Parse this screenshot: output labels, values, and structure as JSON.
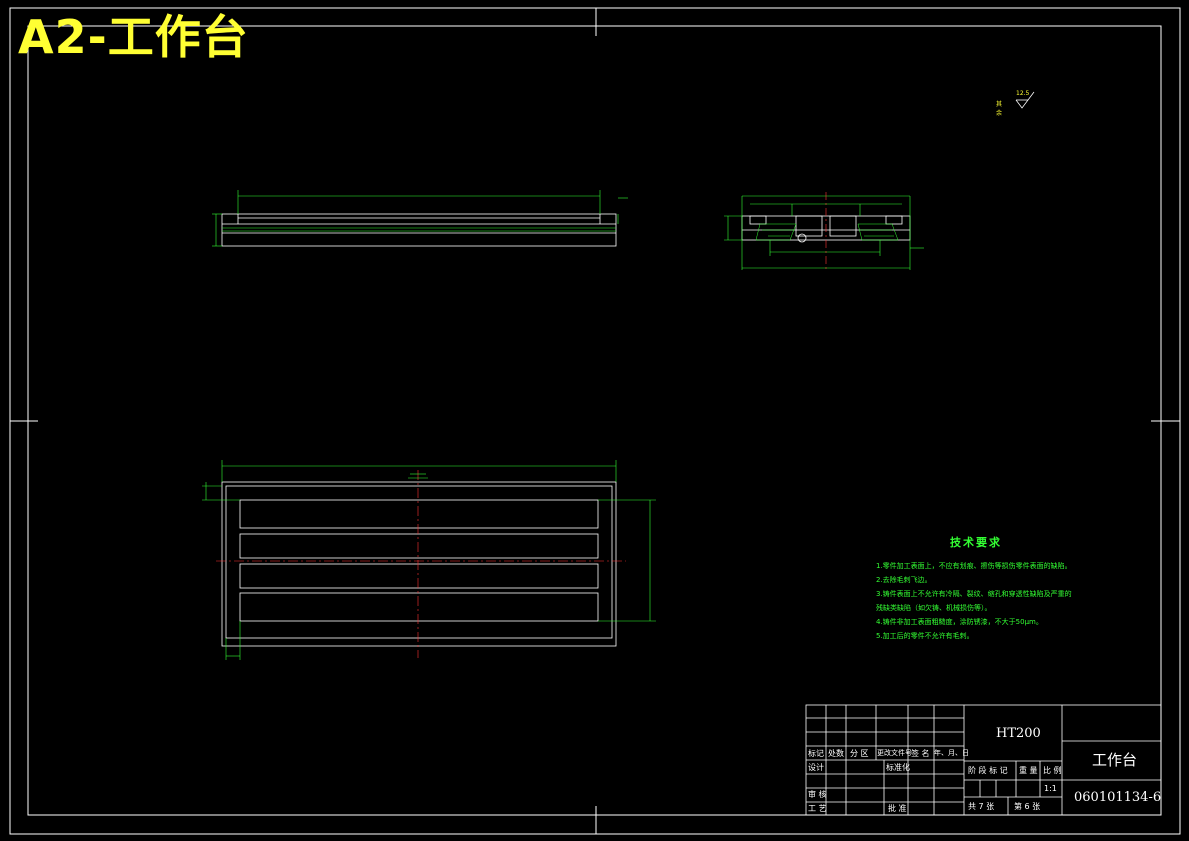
{
  "sheet_title": "A2-工作台",
  "roughness": {
    "label": "其余",
    "value": "12.5"
  },
  "tech_requirements": {
    "title": "技术要求",
    "lines": [
      "1.零件加工表面上，不应有划痕、擦伤等损伤零件表面的缺陷。",
      "2.去除毛刺飞边。",
      "3.铸件表面上不允许有冷隔、裂纹、缩孔和穿透性缺陷及严重的",
      "残缺类缺陷（如欠铸、机械损伤等）。",
      "4.铸件非加工表面粗糙度，涂防锈漆，不大于50μm。",
      "5.加工后的零件不允许有毛刺。"
    ]
  },
  "title_block": {
    "material": "HT200",
    "part_name": "工作台",
    "drawing_number": "060101134-6",
    "scale": "1:1",
    "header_row": [
      "标记",
      "处数",
      "分 区",
      "更改文件号",
      "签 名",
      "年、月、日"
    ],
    "design": "设计",
    "standardize": "标准化",
    "check": "审 核",
    "process": "工 艺",
    "approve": "批 准",
    "stage_mark": "阶 段 标 记",
    "weight": "重 量",
    "ratio": "比 例",
    "sheets_total": "共 7  张",
    "sheet_no": "第  6 张"
  },
  "colors": {
    "frame": "#ffffff",
    "dimension": "#33ff33",
    "centerline": "#ff3333",
    "title": "#ffff33"
  }
}
